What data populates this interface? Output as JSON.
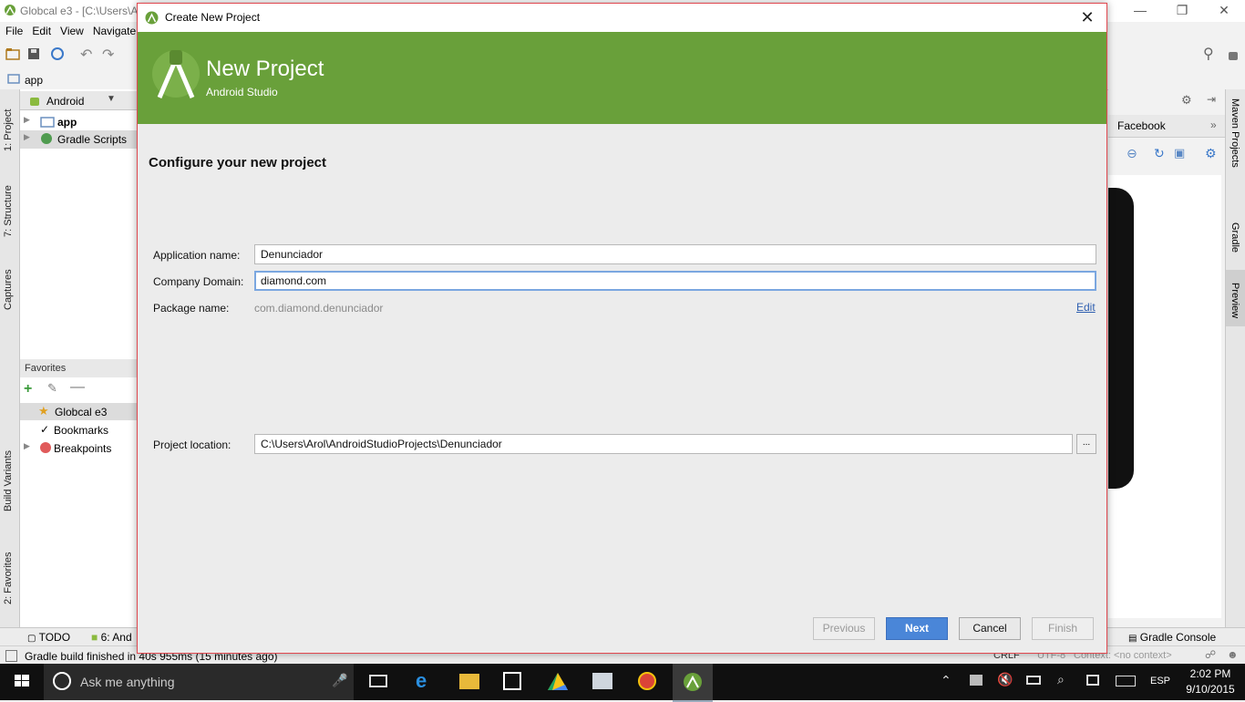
{
  "ide": {
    "title": "Globcal e3 - [C:\\Users\\A",
    "menu": [
      "File",
      "Edit",
      "View",
      "Navigate"
    ],
    "nav_crumb": "app",
    "project_view": "Android",
    "tree": [
      "app",
      "Gradle Scripts"
    ],
    "favorites_title": "Favorites",
    "favorites": [
      "Globcal e3",
      "Bookmarks",
      "Breakpoints"
    ],
    "left_tabs": [
      "1: Project",
      "7: Structure",
      "Captures",
      "Build Variants",
      "2: Favorites"
    ],
    "right_tabs": [
      "Maven Projects",
      "Gradle",
      "Preview"
    ],
    "preview_device": "Facebook",
    "bottom_tabs": [
      "TODO",
      "6: And",
      "Gradle Console"
    ],
    "status": "Gradle build finished in 40s 955ms (15 minutes ago)",
    "status_right": [
      "CRLF",
      "UTF-8",
      "Context: <no context>"
    ]
  },
  "dialog": {
    "title": "Create New Project",
    "banner_title": "New Project",
    "banner_sub": "Android Studio",
    "section_title": "Configure your new project",
    "app_name_label": "Application name:",
    "app_name_value": "Denunciador",
    "company_label": "Company Domain:",
    "company_value": "diamond.com",
    "package_label": "Package name:",
    "package_value": "com.diamond.denunciador",
    "edit_link": "Edit",
    "location_label": "Project location:",
    "location_value": "C:\\Users\\Arol\\AndroidStudioProjects\\Denunciador",
    "browse_label": "...",
    "buttons": {
      "previous": "Previous",
      "next": "Next",
      "cancel": "Cancel",
      "finish": "Finish"
    }
  },
  "taskbar": {
    "search_placeholder": "Ask me anything",
    "time": "2:02 PM",
    "date": "9/10/2015",
    "lang": "ESP"
  },
  "colors": {
    "banner": "#69a03a",
    "primary": "#4a86d8",
    "dialog_border": "#e0484f"
  }
}
